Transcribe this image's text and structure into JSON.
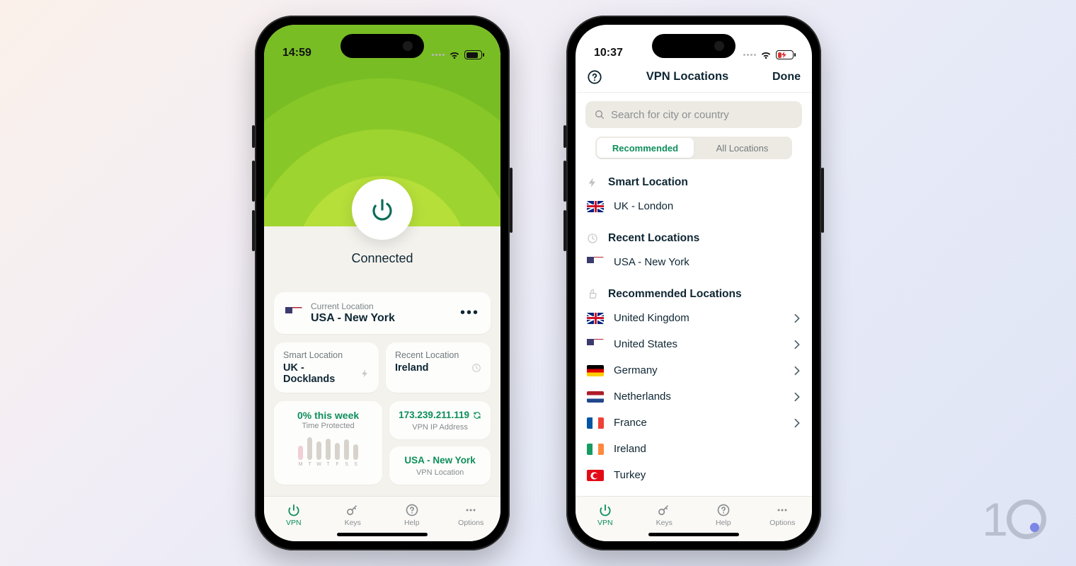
{
  "phone1": {
    "status_time": "14:59",
    "hero_status": "Connected",
    "location_card": {
      "label": "Current Location",
      "value": "USA - New York"
    },
    "smart": {
      "label": "Smart Location",
      "value": "UK - Docklands"
    },
    "recent": {
      "label": "Recent Location",
      "value": "Ireland"
    },
    "time_protected": {
      "pct": "0% this week",
      "sub": "Time Protected",
      "days": [
        "M",
        "T",
        "W",
        "T",
        "F",
        "S",
        "S"
      ]
    },
    "ip_card": {
      "value": "173.239.211.119",
      "sub": "VPN IP Address"
    },
    "vpn_loc_card": {
      "value": "USA - New York",
      "sub": "VPN Location"
    }
  },
  "phone2": {
    "status_time": "10:37",
    "nav": {
      "title": "VPN Locations",
      "done": "Done"
    },
    "search_placeholder": "Search for city or country",
    "seg": {
      "a": "Recommended",
      "b": "All Locations"
    },
    "sections": {
      "smart": "Smart Location",
      "recent": "Recent Locations",
      "recommended": "Recommended Locations"
    },
    "smart_loc": "UK - London",
    "recent_loc": "USA - New York",
    "recommended": [
      {
        "name": "United Kingdom",
        "flag": "uk",
        "chev": true
      },
      {
        "name": "United States",
        "flag": "us",
        "chev": true
      },
      {
        "name": "Germany",
        "flag": "de",
        "chev": true
      },
      {
        "name": "Netherlands",
        "flag": "nl",
        "chev": true
      },
      {
        "name": "France",
        "flag": "fr",
        "chev": true
      },
      {
        "name": "Ireland",
        "flag": "ie",
        "chev": false
      },
      {
        "name": "Turkey",
        "flag": "tr",
        "chev": false
      }
    ]
  },
  "tabs": {
    "vpn": "VPN",
    "keys": "Keys",
    "help": "Help",
    "options": "Options"
  }
}
